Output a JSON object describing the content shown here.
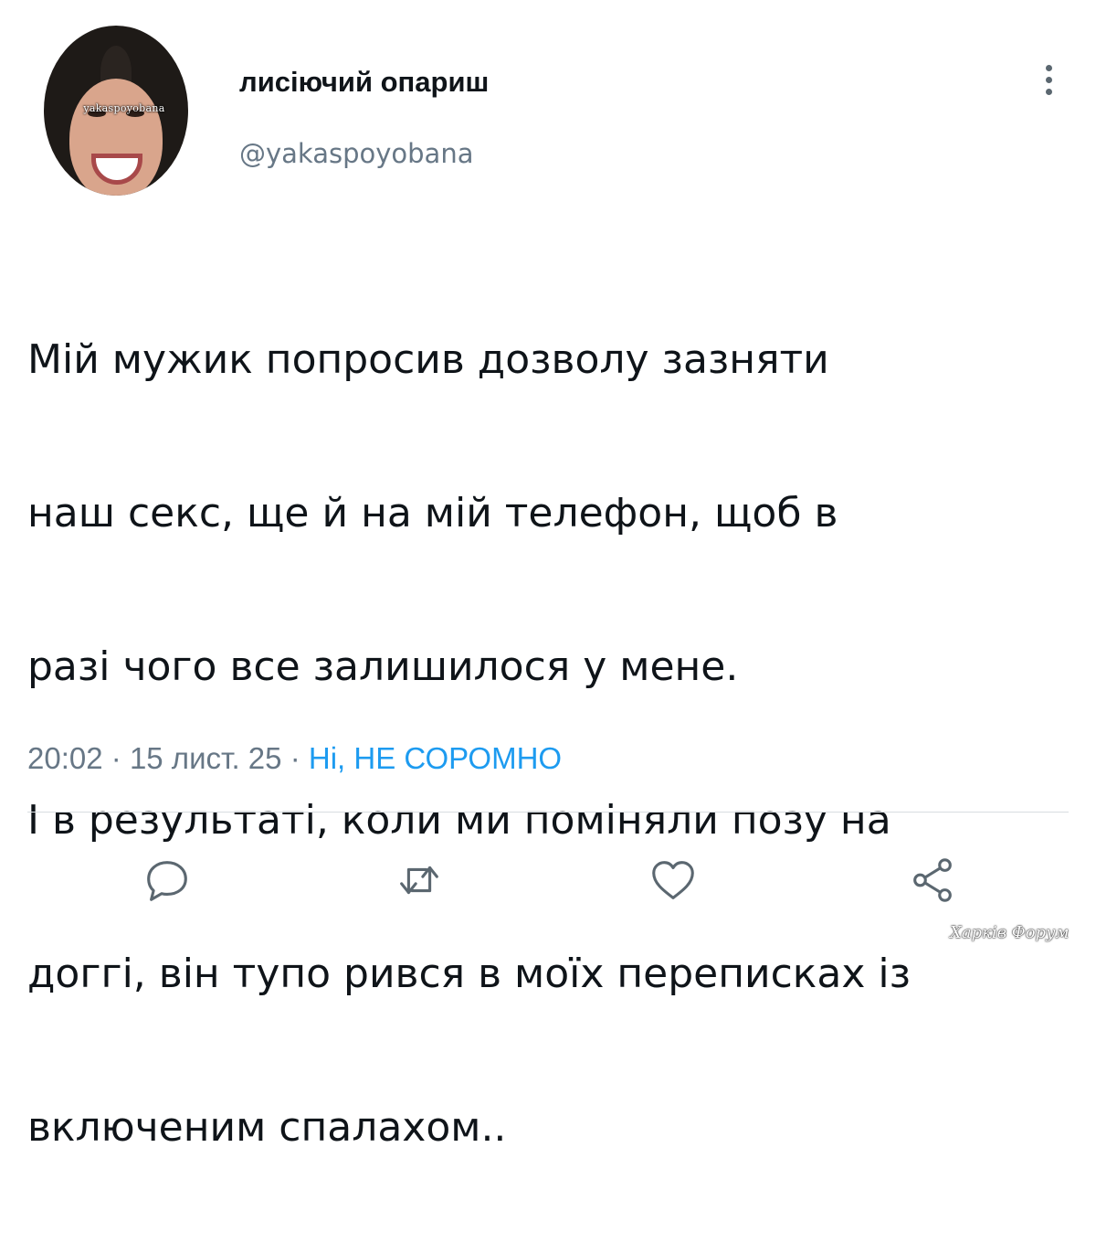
{
  "author": {
    "display_name": "лисіючий опариш",
    "handle": "@yakaspoyobana",
    "avatar_watermark": "yakaspoyobana"
  },
  "tweet": {
    "lines": [
      "Мій мужик попросив дозволу зазняти",
      "наш секс, ще й на мій телефон, щоб в",
      "разі чого все залишилося у мене.",
      "І в результаті, коли ми поміняли позу на",
      "доггі, він тупо рився в моїх переписках із",
      "включеним спалахом.."
    ]
  },
  "meta": {
    "time": "20:02",
    "separator": "·",
    "date": "15 лист. 25",
    "source": "Ні, НЕ СОРОМНО"
  },
  "actions": [
    {
      "name": "reply",
      "icon": "speech-bubble-icon"
    },
    {
      "name": "retweet",
      "icon": "retweet-icon"
    },
    {
      "name": "like",
      "icon": "heart-icon"
    },
    {
      "name": "share",
      "icon": "share-icon"
    }
  ],
  "watermark": "Харків Форум",
  "colors": {
    "text": "#0f1419",
    "secondary": "#677786",
    "link": "#1d9bf0",
    "icon": "#5b6770",
    "divider": "#d8dde1"
  }
}
